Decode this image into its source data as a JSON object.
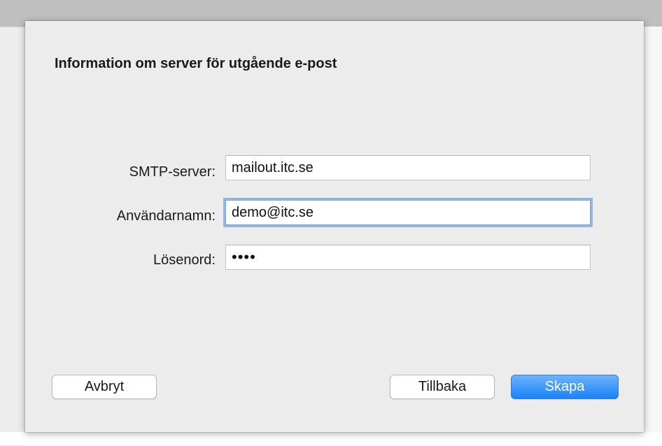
{
  "dialog": {
    "title": "Information om server för utgående e-post"
  },
  "form": {
    "smtp_server": {
      "label": "SMTP-server:",
      "value": "mailout.itc.se"
    },
    "username": {
      "label": "Användarnamn:",
      "value": "demo@itc.se"
    },
    "password": {
      "label": "Lösenord:",
      "value": "••••"
    }
  },
  "buttons": {
    "cancel_label": "Avbryt",
    "back_label": "Tillbaka",
    "create_label": "Skapa"
  },
  "colors": {
    "accent": "#1a82fb",
    "focus_ring": "#8fb6e8",
    "dialog_background": "#ececec"
  }
}
